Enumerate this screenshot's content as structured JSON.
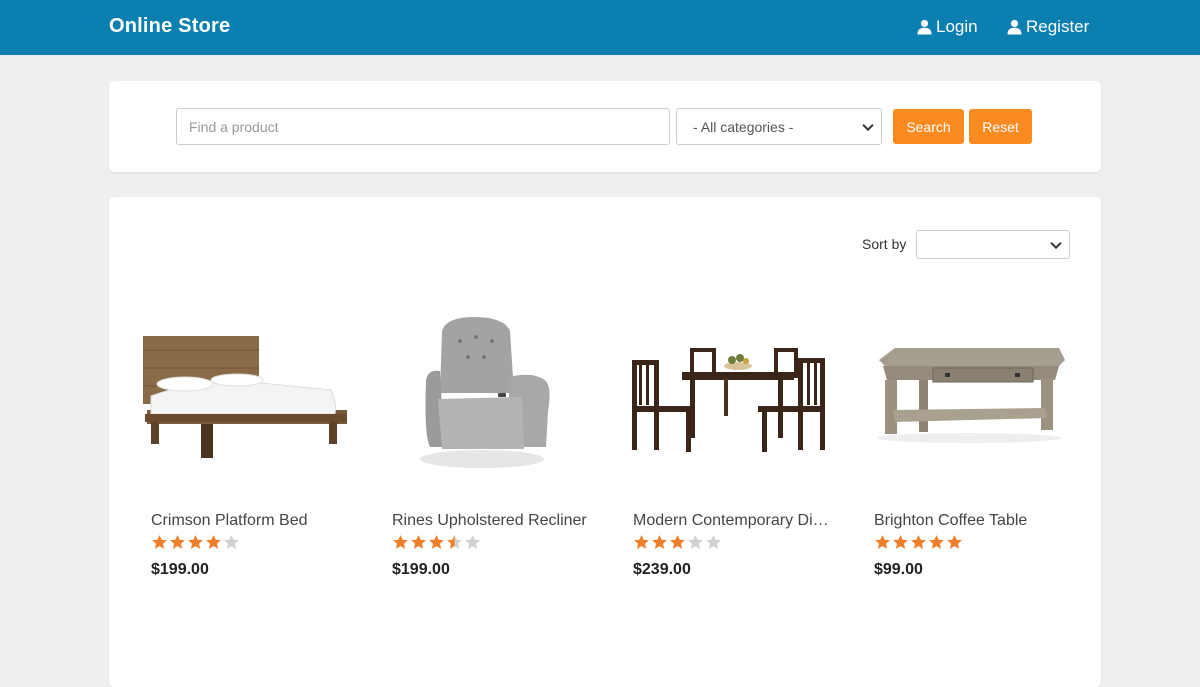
{
  "header": {
    "brand": "Online Store",
    "login_label": "Login",
    "register_label": "Register",
    "background": "#0a7fb0"
  },
  "search": {
    "placeholder": "Find a product",
    "value": "",
    "category_selected": "- All categories -",
    "search_label": "Search",
    "reset_label": "Reset",
    "accent": "#fb8b21"
  },
  "list": {
    "sort_label": "Sort by",
    "sort_selected": ""
  },
  "products": [
    {
      "name": "Crimson Platform Bed",
      "rating": 4,
      "price": "$199.00",
      "image": "platform-bed"
    },
    {
      "name": "Rines Upholstered Recliner",
      "rating": 3.5,
      "price": "$199.00",
      "image": "recliner-chair"
    },
    {
      "name": "Modern Contemporary Dining Set",
      "rating": 3,
      "price": "$239.00",
      "image": "dining-set"
    },
    {
      "name": "Brighton Coffee Table",
      "rating": 5,
      "price": "$99.00",
      "image": "coffee-table"
    }
  ]
}
